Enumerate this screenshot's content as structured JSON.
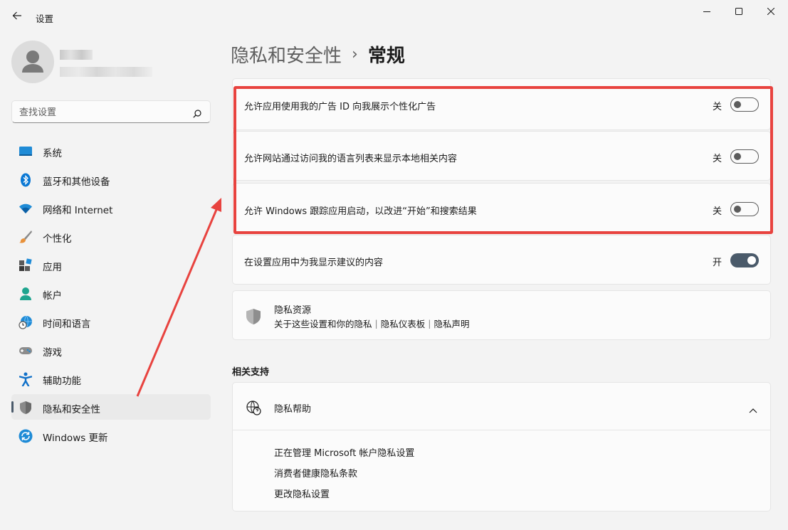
{
  "window": {
    "title": "设置",
    "controls": [
      "minimize",
      "maximize",
      "close"
    ]
  },
  "search": {
    "placeholder": "查找设置"
  },
  "sidebar": {
    "items": [
      {
        "label": "系统",
        "icon": "system-display-icon"
      },
      {
        "label": "蓝牙和其他设备",
        "icon": "bluetooth-icon"
      },
      {
        "label": "网络和 Internet",
        "icon": "wifi-icon"
      },
      {
        "label": "个性化",
        "icon": "brush-icon"
      },
      {
        "label": "应用",
        "icon": "apps-icon"
      },
      {
        "label": "帐户",
        "icon": "account-icon"
      },
      {
        "label": "时间和语言",
        "icon": "globe-clock-icon"
      },
      {
        "label": "游戏",
        "icon": "gamepad-icon"
      },
      {
        "label": "辅助功能",
        "icon": "accessibility-icon"
      },
      {
        "label": "隐私和安全性",
        "icon": "shield-icon",
        "active": true
      },
      {
        "label": "Windows 更新",
        "icon": "update-icon"
      }
    ]
  },
  "breadcrumb": {
    "parent": "隐私和安全性",
    "separator": "›",
    "current": "常规"
  },
  "settings": [
    {
      "label": "允许应用使用我的广告 ID 向我展示个性化广告",
      "state": "关",
      "on": false
    },
    {
      "label": "允许网站通过访问我的语言列表来显示本地相关内容",
      "state": "关",
      "on": false
    },
    {
      "label": "允许 Windows 跟踪应用启动，以改进“开始”和搜索结果",
      "state": "关",
      "on": false
    },
    {
      "label": "在设置应用中为我显示建议的内容",
      "state": "开",
      "on": true
    }
  ],
  "privacy_resources": {
    "title": "隐私资源",
    "links": [
      "关于这些设置和你的隐私",
      "隐私仪表板",
      "隐私声明"
    ],
    "link_separator": "|"
  },
  "related_support": {
    "section_title": "相关支持",
    "help_title": "隐私帮助",
    "links": [
      "正在管理 Microsoft 帐户隐私设置",
      "消费者健康隐私条款",
      "更改隐私设置"
    ]
  },
  "colors": {
    "accent": "#4a5a6a",
    "highlight": "#e8433f",
    "background": "#f3f3f3",
    "card": "#fbfbfb"
  }
}
